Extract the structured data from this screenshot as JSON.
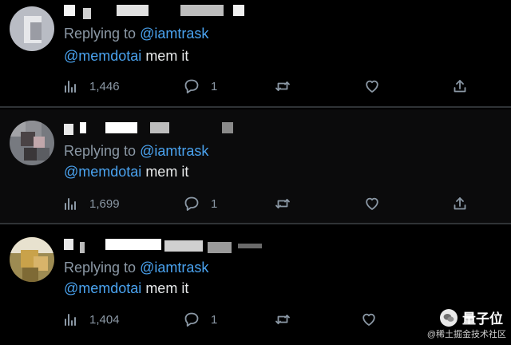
{
  "tweets": [
    {
      "reply_prefix": "Replying to ",
      "reply_handle": "@iamtrask",
      "mention": "@memdotai",
      "text": " mem it",
      "views": "1,446",
      "replies": "1"
    },
    {
      "reply_prefix": "Replying to ",
      "reply_handle": "@iamtrask",
      "mention": "@memdotai",
      "text": " mem it",
      "views": "1,699",
      "replies": "1"
    },
    {
      "reply_prefix": "Replying to ",
      "reply_handle": "@iamtrask",
      "mention": "@memdotai",
      "text": " mem it",
      "views": "1,404",
      "replies": "1"
    }
  ],
  "icons": {
    "views": "bar-chart-icon",
    "reply": "speech-bubble-icon",
    "retweet": "retweet-icon",
    "like": "heart-icon",
    "share": "share-icon"
  },
  "colors": {
    "background": "#000000",
    "divider": "#2f3336",
    "link_blue": "#4aa3f0",
    "muted_gray": "#8b98a5",
    "text": "#e7e9ea"
  },
  "watermark": {
    "brand": "量子位",
    "site": "@稀土掘金技术社区"
  }
}
